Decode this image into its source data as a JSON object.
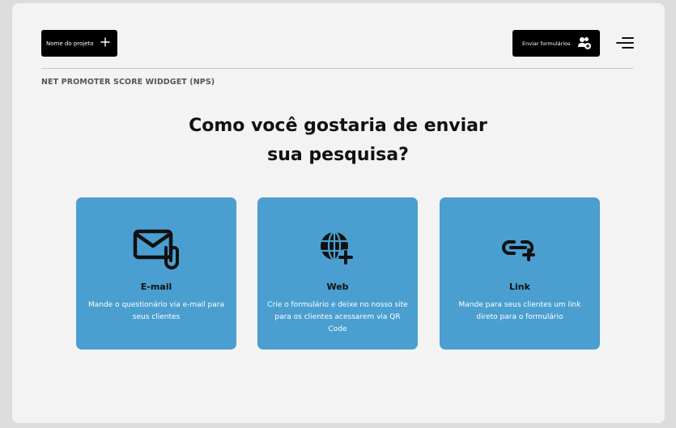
{
  "header": {
    "project_button_label": "Nome do projeto",
    "send_button_label": "Enviar formulários"
  },
  "section_label": "NET PROMOTER SCORE WIDDGET (NPS)",
  "heading": {
    "line1": "Como você gostaria de enviar",
    "line2": "sua pesquisa?"
  },
  "options": [
    {
      "icon": "email-icon",
      "title": "E-mail",
      "desc": "Mande o questionário via e-mail para seus clientes"
    },
    {
      "icon": "globe-plus-icon",
      "title": "Web",
      "desc": "Crie o formulário e deixe no nosso site para os clientes acessarem via QR Code"
    },
    {
      "icon": "link-plus-icon",
      "title": "Link",
      "desc": "Mande para seus clientes um link direto para o formulário"
    }
  ],
  "colors": {
    "accent": "#4a9fd0",
    "button_bg": "#000000",
    "panel_bg": "#f3f3f3"
  }
}
